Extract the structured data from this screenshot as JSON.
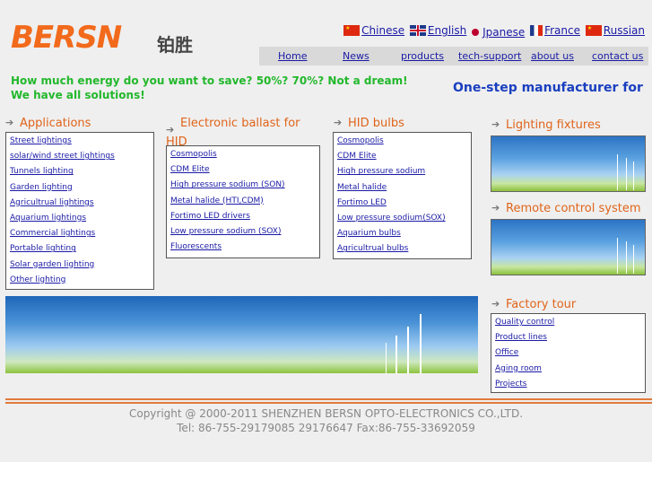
{
  "logo": {
    "text": "BERSN",
    "cn": "铂胜"
  },
  "languages": [
    {
      "flag": "cn-flag-icon",
      "label": "Chinese"
    },
    {
      "flag": "uk-flag-icon",
      "label": "English"
    },
    {
      "flag": "jp-flag-icon",
      "label": "Jpanese"
    },
    {
      "flag": "fr-flag-icon",
      "label": "France"
    },
    {
      "flag": "ru-flag-icon",
      "label": "Russian"
    }
  ],
  "nav": [
    "Home",
    "News",
    "products",
    "tech-support",
    "about us",
    "contact us"
  ],
  "slogan": {
    "line1": "How much energy do you want to save?  50%? 70%?  Not a dream!",
    "line2": "We have all solutions!"
  },
  "tagline": "One-step manufacturer for",
  "applications": {
    "title": "Applications",
    "items": [
      "Street lightings",
      "solar/wind street lightings",
      "Tunnels lighting",
      "Garden lighting",
      "Agricultrual lightings",
      "Aquarium lightings",
      "Commercial lightings",
      "Portable lighting",
      "Solar garden lighting",
      "Other lighting"
    ]
  },
  "ballast": {
    "title": "Electronic ballast for HID",
    "items": [
      "Cosmopolis",
      "CDM Elite",
      "High pressure sodium (SON)",
      "Metal halide (HTI,CDM)",
      "Fortimo LED drivers",
      "Low pressure sodium (SOX)",
      "Fluorescents"
    ]
  },
  "hid": {
    "title": "HID bulbs",
    "items": [
      "Cosmopolis",
      "CDM Elite",
      "High pressure sodium",
      "Metal halide",
      "Fortimo LED",
      "Low pressure sodium(SOX)",
      "Aquarium bulbs",
      "Agricultrual bulbs"
    ]
  },
  "fixtures": {
    "title": "Lighting fixtures"
  },
  "remote": {
    "title": "Remote control system"
  },
  "factory": {
    "title": "Factory tour",
    "items": [
      "Quality control",
      "Product lines",
      "Office",
      "Aging room",
      "Projects"
    ]
  },
  "footer": {
    "line1": "Copyright @ 2000-2011 SHENZHEN BERSN OPTO-ELECTRONICS CO.,LTD.",
    "line2": "Tel: 86-755-29179085 29176647 Fax:86-755-33692059"
  },
  "colors": {
    "accent": "#e0641a",
    "link": "#1a1aa6",
    "slogan": "#22b82b",
    "tagline": "#1a3fbf"
  }
}
